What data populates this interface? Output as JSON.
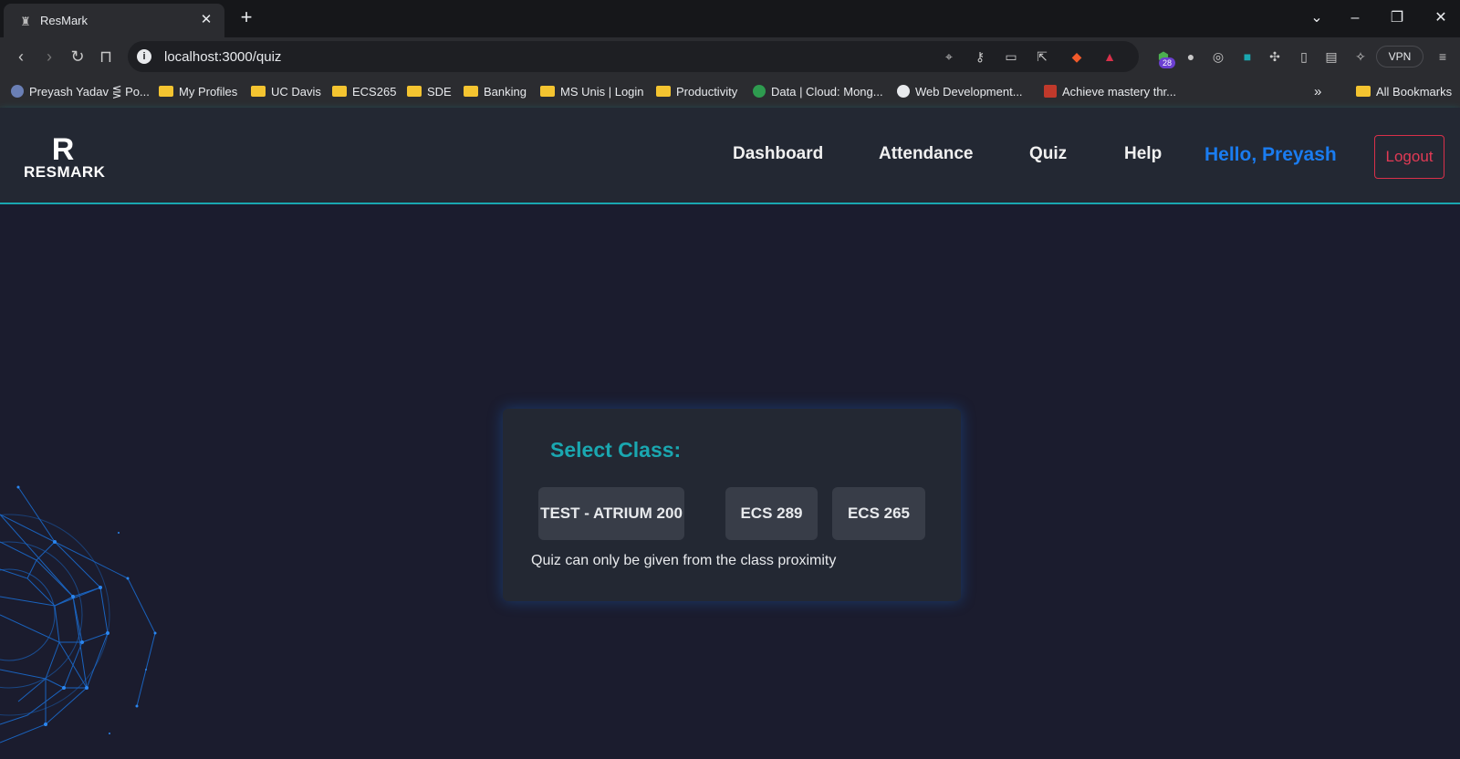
{
  "browser": {
    "tab_title": "ResMark",
    "url": "localhost:3000/quiz",
    "vpn_label": "VPN",
    "extension_badge": "28",
    "bookmarks": [
      {
        "label": "Preyash Yadav ⋚ Po...",
        "icon": "shield-icon"
      },
      {
        "label": "My Profiles",
        "icon": "folder-icon"
      },
      {
        "label": "UC Davis",
        "icon": "folder-icon"
      },
      {
        "label": "ECS265",
        "icon": "folder-icon"
      },
      {
        "label": "SDE",
        "icon": "folder-icon"
      },
      {
        "label": "Banking",
        "icon": "folder-icon"
      },
      {
        "label": "MS Unis | Login",
        "icon": "folder-icon"
      },
      {
        "label": "Productivity",
        "icon": "folder-icon"
      },
      {
        "label": "Data | Cloud: Mong...",
        "icon": "leaf-icon"
      },
      {
        "label": "Web Development...",
        "icon": "circle-icon"
      },
      {
        "label": "Achieve mastery thr...",
        "icon": "red-square-icon"
      }
    ],
    "all_bookmarks_label": "All Bookmarks"
  },
  "header": {
    "logo_mark": "R",
    "logo_text": "RESMARK",
    "nav": [
      "Dashboard",
      "Attendance",
      "Quiz",
      "Help"
    ],
    "greeting": "Hello, Preyash",
    "logout_label": "Logout"
  },
  "card": {
    "heading": "Select Class:",
    "classes": [
      "TEST - ATRIUM 200",
      "ECS 289",
      "ECS 265"
    ],
    "note": "Quiz can only be given from the class proximity"
  },
  "colors": {
    "accent": "#1aa7b0",
    "greeting": "#1a7cf0",
    "logout": "#e23a55",
    "background": "#1b1c2e",
    "panel": "#232833"
  }
}
